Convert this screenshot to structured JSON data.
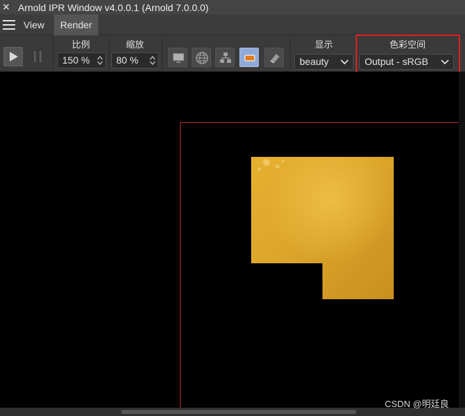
{
  "window": {
    "title": "Arnold IPR Window v4.0.0.1 (Arnold 7.0.0.0)",
    "close_glyph": "✕"
  },
  "menubar": {
    "items": [
      {
        "label": "View"
      },
      {
        "label": "Render"
      }
    ],
    "active": "Render"
  },
  "toolbar": {
    "play_icon": "play-icon",
    "pause_icon": "pause-icon",
    "scale": {
      "label": "比例",
      "value": "150 %"
    },
    "exposure": {
      "label": "缩放",
      "value": "80 %"
    },
    "icons": [
      "monitor-icon",
      "globe-icon",
      "network-icon",
      "region-icon",
      "eraser-icon"
    ],
    "active_icon": "region-icon",
    "display": {
      "label": "显示",
      "value": "beauty"
    },
    "colorspace": {
      "label": "色彩空间",
      "value": "Output - sRGB"
    },
    "highlight_color": "#e0201e"
  },
  "viewport": {
    "background": "#000000",
    "region_border_color": "#b8302a",
    "render_color": "#d8a22a"
  },
  "watermark": "CSDN @明廷良"
}
